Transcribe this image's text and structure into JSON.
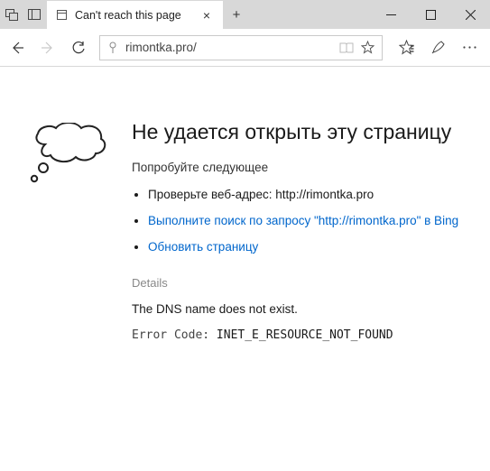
{
  "titlebar": {
    "tab_title": "Can't reach this page"
  },
  "navbar": {
    "url": "rimontka.pro/"
  },
  "page": {
    "heading": "Не удается открыть эту страницу",
    "try_following": "Попробуйте следующее",
    "check_address_prefix": "Проверьте веб-адрес: ",
    "check_address_url": "http://rimontka.pro",
    "search_link": "Выполните поиск по запросу \"http://rimontka.pro\" в Bing",
    "refresh_link": "Обновить страницу",
    "details_heading": "Details",
    "dns_msg": "The DNS name does not exist.",
    "error_code_label": "Error Code: ",
    "error_code": "INET_E_RESOURCE_NOT_FOUND"
  }
}
